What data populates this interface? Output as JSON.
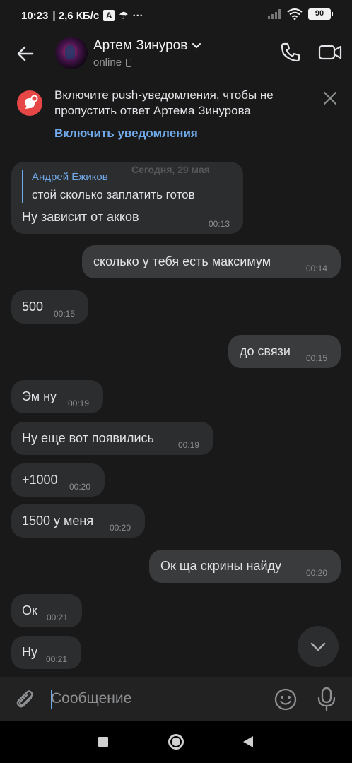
{
  "status_bar": {
    "time": "10:23",
    "net_speed": "| 2,6 КБ/с",
    "battery": "90",
    "dots": "···"
  },
  "header": {
    "contact_name": "Артем Зинуров",
    "status": "online"
  },
  "banner": {
    "text": "Включите push-уведомления, чтобы не пропустить ответ Артема Зинурова",
    "link": "Включить уведомления"
  },
  "date_label": "Сегодня, 29 мая",
  "messages": [
    {
      "dir": "in",
      "reply_author": "Андрей Ёжиков",
      "reply_text": "стой сколько заплатить готов",
      "text": "Ну зависит от акков",
      "time": "00:13"
    },
    {
      "dir": "out",
      "text": "сколько у тебя есть максимум",
      "time": "00:14"
    },
    {
      "dir": "in",
      "text": "500",
      "time": "00:15"
    },
    {
      "dir": "out",
      "text": "до связи",
      "time": "00:15"
    },
    {
      "dir": "in",
      "text": "Эм ну",
      "time": "00:19"
    },
    {
      "dir": "in",
      "text": "Ну еще вот появились",
      "time": "00:19"
    },
    {
      "dir": "in",
      "text": "+1000",
      "time": "00:20"
    },
    {
      "dir": "in",
      "text": "1500 у меня",
      "time": "00:20"
    },
    {
      "dir": "out",
      "text": "Ок ща скрины найду",
      "time": "00:20"
    },
    {
      "dir": "in",
      "text": "Ок",
      "time": "00:21"
    },
    {
      "dir": "in",
      "text": "Ну",
      "time": "00:21"
    }
  ],
  "input": {
    "placeholder": "Сообщение"
  },
  "colors": {
    "accent": "#71aaeb",
    "background": "#19191a",
    "bubble_in": "#2c2d2e",
    "bubble_out": "#3a3b3c",
    "banner_icon": "#e64646"
  }
}
